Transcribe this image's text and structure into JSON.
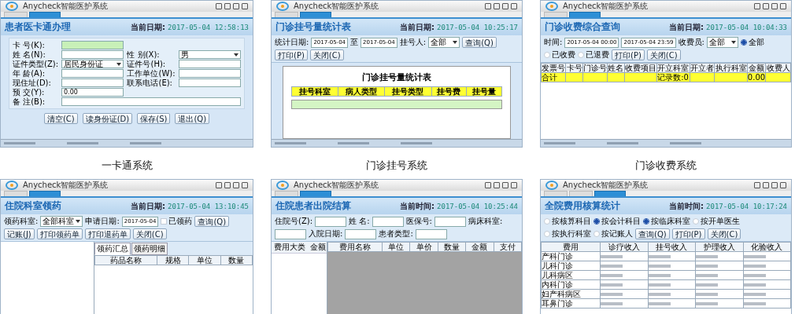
{
  "screens": [
    {
      "caption": "一卡通系统",
      "title": "Anycheck智能医护系统",
      "tabs": [
        {
          "selected": false
        },
        {
          "selected": true
        }
      ],
      "heading": "患者医卡通办理",
      "clock_label": "当前日期:",
      "clock": "2017-05-04 12:58:13",
      "content": {
        "kind": "form",
        "rows": [
          [
            {
              "label": "卡 号(K):",
              "kind": "text",
              "highlight": true
            }
          ],
          [
            {
              "label": "姓 名(N):",
              "kind": "text",
              "highlight": false
            },
            {
              "label": "性 别(X):",
              "kind": "select",
              "value": "男",
              "highlight": false
            }
          ],
          [
            {
              "label": "证件类型(Z):",
              "kind": "select",
              "value": "居民身份证",
              "highlight": false
            },
            {
              "label": "证件号(H):",
              "kind": "text",
              "highlight": false
            }
          ],
          [
            {
              "label": "年 龄(A):",
              "kind": "text",
              "highlight": false
            },
            {
              "label": "工作单位(W):",
              "kind": "text",
              "highlight": false
            }
          ],
          [
            {
              "label": "现住址(D):",
              "kind": "text",
              "highlight": false
            },
            {
              "label": "联系电话(E):",
              "kind": "text",
              "highlight": false
            }
          ],
          [
            {
              "label": "预 交(Y):",
              "kind": "text",
              "value": "0.00",
              "highlight": false
            }
          ],
          [
            {
              "label": "备 注(B):",
              "kind": "wide",
              "highlight": false
            }
          ]
        ],
        "buttons": [
          "清空(C)",
          "读身份证(D)",
          "保存(S)",
          "退出(Q)"
        ]
      }
    },
    {
      "caption": "门诊挂号系统",
      "title": "Anycheck智能医护系统",
      "tabs": [
        {
          "selected": false
        },
        {
          "selected": true
        }
      ],
      "heading": "门诊挂号量统计表",
      "clock_label": "当前日期:",
      "clock": "2017-05-04 10:25:17",
      "toolbar": [
        {
          "kind": "label",
          "text": "统计日期:"
        },
        {
          "kind": "field",
          "text": "2017-05-04"
        },
        {
          "kind": "label",
          "text": "至"
        },
        {
          "kind": "field",
          "text": "2017-05-04"
        },
        {
          "kind": "label",
          "text": "挂号人:"
        },
        {
          "kind": "select",
          "text": "全部"
        },
        {
          "kind": "button",
          "text": "查询(Q)"
        },
        {
          "kind": "button",
          "text": "打印(P)"
        },
        {
          "kind": "button",
          "text": "关闭(C)"
        }
      ],
      "content": {
        "kind": "report",
        "title": "门诊挂号量统计表",
        "columns": [
          "挂号科室",
          "病人类型",
          "挂号类型",
          "挂号费",
          "挂号量"
        ]
      }
    },
    {
      "caption": "门诊收费系统",
      "title": "Anycheck智能医护系统",
      "tabs": [
        {
          "selected": false
        },
        {
          "selected": true
        }
      ],
      "heading": "门诊收费综合查询",
      "clock_label": "当前日期:",
      "clock": "2017-05-04 10:04:33",
      "toolbar": [
        {
          "kind": "label",
          "text": "时间:"
        },
        {
          "kind": "field",
          "text": "2017-05-04 00:00"
        },
        {
          "kind": "field",
          "text": "2017-05-04 23:59"
        },
        {
          "kind": "label",
          "text": "收费员:"
        },
        {
          "kind": "select",
          "text": "全部"
        },
        {
          "kind": "radio",
          "text": "全部",
          "selected": true
        },
        {
          "kind": "radio",
          "text": "已收费",
          "selected": false
        },
        {
          "kind": "radio",
          "text": "已退费",
          "selected": false
        },
        {
          "kind": "button",
          "text": "打印(P)"
        },
        {
          "kind": "button",
          "text": "关闭(C)"
        }
      ],
      "content": {
        "kind": "grid",
        "dark": false,
        "columns": [
          "发票号",
          "卡号",
          "门诊号",
          "姓名",
          "收费项目",
          "开立科室",
          "开立者",
          "执行科室",
          "金额",
          "收费人"
        ],
        "rows": [
          {
            "kind": "sum",
            "cells": [
              "合计",
              null,
              null,
              null,
              null,
              "记录数:0",
              null,
              null,
              "0.00",
              null
            ]
          }
        ]
      }
    },
    {
      "title": "Anycheck智能医护系统",
      "tabs": [
        {
          "selected": false
        },
        {
          "selected": true
        }
      ],
      "heading": "住院科室领药",
      "clock_label": "当前日期:",
      "clock": "2017-05-04 13:10:45",
      "toolbar": [
        {
          "kind": "label",
          "text": "领药科室:"
        },
        {
          "kind": "select",
          "text": "全部科室"
        },
        {
          "kind": "label",
          "text": "申请日期:"
        },
        {
          "kind": "field",
          "text": "2017-05-04"
        },
        {
          "kind": "check",
          "text": "已领药",
          "selected": false
        },
        {
          "kind": "button",
          "text": "查询(Q)"
        },
        {
          "kind": "button",
          "text": "记账(J)"
        },
        {
          "kind": "button",
          "text": "打印领药单"
        },
        {
          "kind": "button",
          "text": "打印退药单"
        },
        {
          "kind": "button",
          "text": "关闭(C)"
        }
      ],
      "content": {
        "kind": "grid",
        "dark": false,
        "side": {
          "kind": "blank"
        },
        "subtabs": [
          {
            "label": "领药汇总",
            "selected": true
          },
          {
            "label": "领药明细",
            "selected": false
          }
        ],
        "columns": [
          "药品名称",
          "规格",
          "单位",
          "数量"
        ]
      }
    },
    {
      "title": "Anycheck智能医护系统",
      "tabs": [
        {
          "selected": false
        },
        {
          "selected": true
        }
      ],
      "heading": "住院患者出院结算",
      "clock_label": "当前时间:",
      "clock": "2017-05-04 10:25:44",
      "toolbar": [
        {
          "kind": "label",
          "text": "住院号(Z):"
        },
        {
          "kind": "field"
        },
        {
          "kind": "label",
          "text": "姓 名:"
        },
        {
          "kind": "field"
        },
        {
          "kind": "label",
          "text": "医保号:"
        },
        {
          "kind": "field"
        },
        {
          "kind": "label",
          "text": "病床科室:"
        },
        {
          "kind": "field"
        },
        {
          "kind": "label",
          "text": "入院日期:"
        },
        {
          "kind": "field"
        },
        {
          "kind": "label",
          "text": "患者类型:"
        },
        {
          "kind": "field"
        }
      ],
      "content": {
        "kind": "grid",
        "dark": true,
        "side": {
          "kind": "columns",
          "columns": [
            "费用大类",
            "金额"
          ]
        },
        "columns": [
          "费用名称",
          "单位",
          "单价",
          "数量",
          "金额",
          "支付"
        ]
      }
    },
    {
      "title": "Anycheck智能医护系统",
      "tabs": [
        {
          "selected": false
        },
        {
          "selected": false
        },
        {
          "selected": true
        }
      ],
      "heading": "全院费用核算统计",
      "clock_label": "当前时间:",
      "clock": "2017-05-04 10:17:24",
      "toolbar": [
        {
          "kind": "radio",
          "text": "按核算科目",
          "selected": false
        },
        {
          "kind": "radio",
          "text": "按会计科目",
          "selected": true
        },
        {
          "kind": "radio",
          "text": "按临床科室",
          "selected": true
        },
        {
          "kind": "radio",
          "text": "按开单医生",
          "selected": false
        },
        {
          "kind": "radio",
          "text": "按执行科室",
          "selected": false
        },
        {
          "kind": "radio",
          "text": "按记账人",
          "selected": false
        },
        {
          "kind": "button",
          "text": "查询(Q)"
        },
        {
          "kind": "button",
          "text": "打印(P)"
        },
        {
          "kind": "button",
          "text": "关闭(C)"
        }
      ],
      "content": {
        "kind": "grid",
        "dark": false,
        "columns": [
          "费用",
          "诊疗收入",
          "挂号收入",
          "护理收入",
          "化验收入"
        ],
        "rows": [
          {
            "kind": "data",
            "cells": [
              "产科门诊",
              null,
              null,
              null,
              null
            ]
          },
          {
            "kind": "data",
            "cells": [
              "儿科门诊",
              null,
              null,
              null,
              null
            ]
          },
          {
            "kind": "data",
            "cells": [
              "儿科病区",
              null,
              null,
              null,
              null
            ]
          },
          {
            "kind": "data",
            "cells": [
              "内科门诊",
              null,
              null,
              null,
              null
            ]
          },
          {
            "kind": "data",
            "cells": [
              "妇产科病区",
              null,
              null,
              null,
              null
            ]
          },
          {
            "kind": "data",
            "cells": [
              "耳鼻门诊",
              null,
              null,
              null,
              null
            ]
          }
        ]
      }
    }
  ]
}
